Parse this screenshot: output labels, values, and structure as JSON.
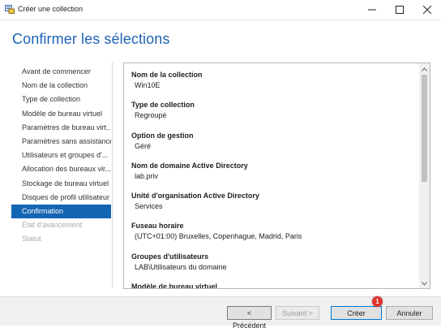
{
  "window": {
    "title": "Créer une collection",
    "icons": {
      "app": "server-manager-icon",
      "minimize": "minimize-icon",
      "maximize": "maximize-icon",
      "close": "close-icon"
    }
  },
  "heading": "Confirmer les sélections",
  "steps": [
    {
      "label": "Avant de commencer",
      "state": "normal"
    },
    {
      "label": "Nom de la collection",
      "state": "normal"
    },
    {
      "label": "Type de collection",
      "state": "normal"
    },
    {
      "label": "Modèle de bureau virtuel",
      "state": "normal"
    },
    {
      "label": "Paramètres de bureau virt...",
      "state": "normal"
    },
    {
      "label": "Paramètres sans assistance",
      "state": "normal"
    },
    {
      "label": "Utilisateurs et groupes d'...",
      "state": "normal"
    },
    {
      "label": "Allocation des bureaux vir...",
      "state": "normal"
    },
    {
      "label": "Stockage de bureau virtuel",
      "state": "normal"
    },
    {
      "label": "Disques de profil utilisateur",
      "state": "normal"
    },
    {
      "label": "Confirmation",
      "state": "active"
    },
    {
      "label": "État d'avancement",
      "state": "disabled"
    },
    {
      "label": "Statut",
      "state": "disabled"
    }
  ],
  "summary": [
    {
      "label": "Nom de la collection",
      "value": "Win10E"
    },
    {
      "label": "Type de collection",
      "value": "Regroupé"
    },
    {
      "label": "Option de gestion",
      "value": "Géré"
    },
    {
      "label": "Nom de domaine Active Directory",
      "value": "lab.priv"
    },
    {
      "label": "Unité d'organisation Active Directory",
      "value": "Services"
    },
    {
      "label": "Fuseau horaire",
      "value": "(UTC+01:00) Bruxelles, Copenhague, Madrid, Paris"
    },
    {
      "label": "Groupes d'utilisateurs",
      "value": "LAB\\Utilisateurs du domaine"
    },
    {
      "label": "Modèle de bureau virtuel",
      "value": ""
    }
  ],
  "buttons": {
    "previous": "< Précédent",
    "next": "Suivant >",
    "create": "Créer",
    "cancel": "Annuler"
  },
  "badge": "1",
  "colors": {
    "accent": "#1465b3",
    "heading": "#1e63b6",
    "badge": "#e4312a"
  }
}
